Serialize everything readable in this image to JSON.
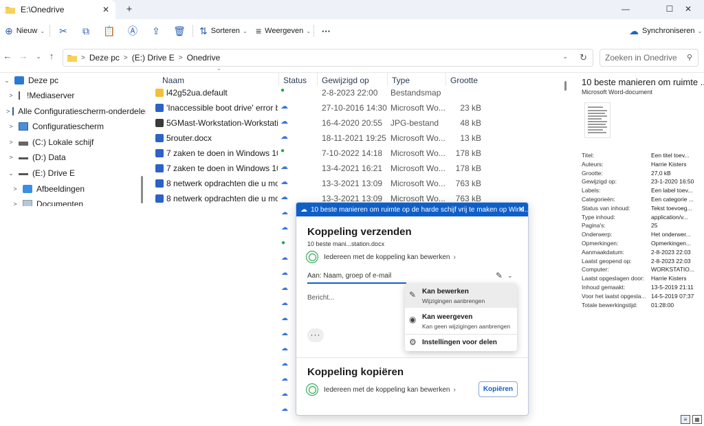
{
  "window": {
    "tab_title": "E:\\Onedrive",
    "tab_close": "✕",
    "new_tab": "+",
    "minimize": "—",
    "maximize": "☐",
    "close": "✕"
  },
  "toolbar": {
    "new_label": "Nieuw",
    "sort_label": "Sorteren",
    "view_label": "Weergeven",
    "more_label": "···",
    "sync_label": "Synchroniseren"
  },
  "address": {
    "crumbs": [
      "Deze pc",
      "(E:) Drive E",
      "Onedrive"
    ],
    "separator": ">"
  },
  "search": {
    "placeholder": "Zoeken in Onedrive"
  },
  "nav_tree": [
    {
      "label": "Deze pc",
      "expand": "⌄",
      "icon": "monitor-icon"
    },
    {
      "label": "!Mediaserver",
      "expand": ">",
      "icon": "network-drive-icon"
    },
    {
      "label": "Alle Configuratiescherm-onderdelen",
      "expand": ">",
      "icon": "control-panel-icon"
    },
    {
      "label": "Configuratiescherm",
      "expand": ">",
      "icon": "control-panel-icon"
    },
    {
      "label": "(C:) Lokale schijf",
      "expand": ">",
      "icon": "drive-icon"
    },
    {
      "label": "(D:) Data",
      "expand": ">",
      "icon": "drive-icon"
    },
    {
      "label": "(E:) Drive E",
      "expand": "⌄",
      "icon": "drive-icon"
    },
    {
      "label": "Afbeeldingen",
      "expand": ">",
      "icon": "pictures-icon"
    },
    {
      "label": "Documenten",
      "expand": ">",
      "icon": "documents-icon"
    }
  ],
  "columns": {
    "name": "Naam",
    "status": "Status",
    "modified": "Gewijzigd op",
    "type": "Type",
    "size": "Grootte"
  },
  "files": [
    {
      "name": "l42g52ua.default",
      "status": "synced",
      "modified": "2-8-2023 22:00",
      "type": "Bestandsmap",
      "size": "",
      "icon": "folder-icon"
    },
    {
      "name": "'Inaccessible boot drive' error b...",
      "status": "cloud",
      "modified": "27-10-2016 14:30",
      "type": "Microsoft Wo...",
      "size": "23 kB",
      "icon": "word-icon"
    },
    {
      "name": "5GMast-Workstation-Workstati...",
      "status": "cloud",
      "modified": "16-4-2020 20:55",
      "type": "JPG-bestand",
      "size": "48 kB",
      "icon": "image-file-icon"
    },
    {
      "name": "5router.docx",
      "status": "cloud",
      "modified": "18-11-2021 19:25",
      "type": "Microsoft Wo...",
      "size": "13 kB",
      "icon": "word-icon"
    },
    {
      "name": "7 zaken te doen in Windows 10...",
      "status": "synced",
      "modified": "7-10-2022 14:18",
      "type": "Microsoft Wo...",
      "size": "178 kB",
      "icon": "word-icon"
    },
    {
      "name": "7 zaken te doen in Windows 10...",
      "status": "cloud",
      "modified": "13-4-2021 16:21",
      "type": "Microsoft Wo...",
      "size": "178 kB",
      "icon": "word-icon"
    },
    {
      "name": "8 netwerk opdrachten die u mo...",
      "status": "cloud",
      "modified": "13-3-2021 13:09",
      "type": "Microsoft Wo...",
      "size": "763 kB",
      "icon": "word-icon"
    },
    {
      "name": "8 netwerk opdrachten die u mo...",
      "status": "cloud",
      "modified": "13-3-2021 13:09",
      "type": "Microsoft Wo...",
      "size": "763 kB",
      "icon": "word-icon"
    }
  ],
  "fragments": [
    "",
    "",
    "t.",
    "",
    "",
    "",
    "",
    "",
    "",
    "",
    "",
    ""
  ],
  "details": {
    "title": "10 beste manieren om ruimte ...",
    "subtitle": "Microsoft Word-document",
    "props": [
      {
        "k": "Titel:",
        "v": "Een titel toev..."
      },
      {
        "k": "Auteurs:",
        "v": "Harrie Kisters"
      },
      {
        "k": "Grootte:",
        "v": "27,0 kB"
      },
      {
        "k": "Gewijzigd op:",
        "v": "23-1-2020 16:50"
      },
      {
        "k": "Labels:",
        "v": "Een label toev..."
      },
      {
        "k": "Categorieën:",
        "v": "Een categorie ..."
      },
      {
        "k": "Status van inhoud:",
        "v": "Tekst toevoeg..."
      },
      {
        "k": "Type inhoud:",
        "v": "application/v..."
      },
      {
        "k": "Pagina's:",
        "v": "25"
      },
      {
        "k": "Onderwerp:",
        "v": "Het onderwer..."
      },
      {
        "k": "Opmerkingen:",
        "v": "Opmerkingen..."
      },
      {
        "k": "Aanmaakdatum:",
        "v": "2-8-2023 22:03"
      },
      {
        "k": "Laatst geopend op:",
        "v": "2-8-2023 22:03"
      },
      {
        "k": "Computer:",
        "v": "WORKSTATIO..."
      },
      {
        "k": "Laatst opgeslagen door:",
        "v": "Harrie Kisters"
      },
      {
        "k": "Inhoud gemaakt:",
        "v": "13-5-2019 21:11"
      },
      {
        "k": "Voor het laatst opgesla...",
        "v": "14-5-2019 07:37"
      },
      {
        "k": "Totale bewerkingstijd:",
        "v": "01:28:00"
      }
    ]
  },
  "share": {
    "header": "10 beste manieren om ruimte op de harde schijf vrij te maken op Wind...",
    "close": "✕",
    "send_title": "Koppeling verzenden",
    "file_name": "10 beste mani...station.docx",
    "permission": "Iedereen met de koppeling kan bewerken",
    "to_placeholder": "Aan: Naam, groep of e-mail",
    "message_placeholder": "Bericht...",
    "more": "···",
    "copy_title": "Koppeling kopiëren",
    "copy_permission": "Iedereen met de koppeling kan bewerken",
    "copy_button": "Kopiëren"
  },
  "menu": {
    "items": [
      {
        "title": "Kan bewerken",
        "sub": "Wijzigingen aanbrengen"
      },
      {
        "title": "Kan weergeven",
        "sub": "Kan geen wijzigingen aanbrengen"
      },
      {
        "title": "Instellingen voor delen",
        "sub": ""
      }
    ]
  },
  "colors": {
    "accent": "#0f5fc9",
    "synced": "#21a348",
    "cloud": "#3a78d8"
  }
}
